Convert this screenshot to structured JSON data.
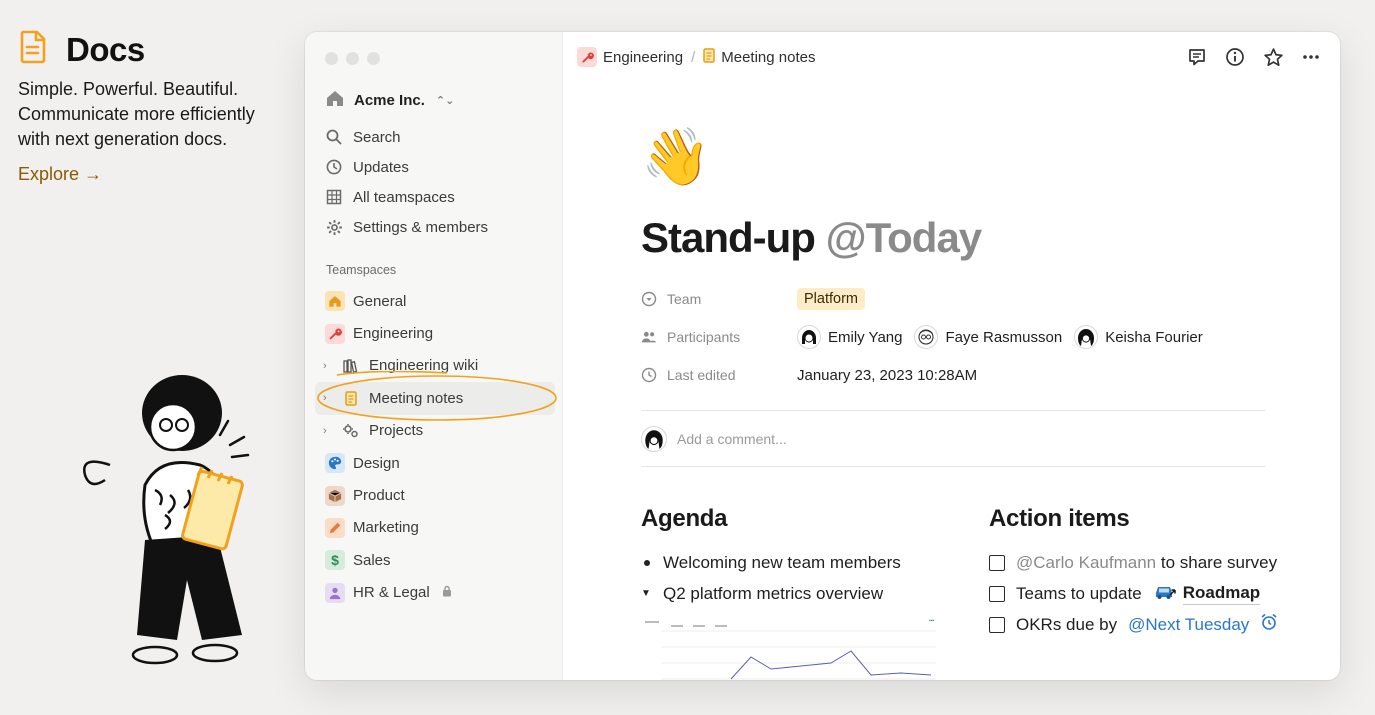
{
  "hero": {
    "title": "Docs",
    "icon": "document-icon",
    "description_lines": [
      "Simple. Powerful. Beautiful.",
      "Communicate more efficiently",
      "with next generation docs."
    ],
    "explore_label": "Explore →",
    "accent_color": "#f0a21e"
  },
  "sidebar": {
    "workspace_name": "Acme Inc.",
    "nav": [
      {
        "label": "Search",
        "icon": "search-icon"
      },
      {
        "label": "Updates",
        "icon": "clock-icon"
      },
      {
        "label": "All teamspaces",
        "icon": "grid-icon"
      },
      {
        "label": "Settings & members",
        "icon": "gear-icon"
      }
    ],
    "teamspaces_label": "Teamspaces",
    "teamspaces": [
      {
        "label": "General",
        "icon": "house-icon",
        "color": "#f2b84b"
      },
      {
        "label": "Engineering",
        "icon": "wrench-icon",
        "color": "#e5534b"
      },
      {
        "label": "Engineering wiki",
        "icon": "books-icon",
        "color": "#6b6b6b"
      },
      {
        "label": "Meeting notes",
        "icon": "notepad-icon",
        "color": "#f0a21e"
      },
      {
        "label": "Projects",
        "icon": "gears-icon",
        "color": "#6b6b6b"
      },
      {
        "label": "Design",
        "icon": "palette-icon",
        "color": "#2a78c5"
      },
      {
        "label": "Product",
        "icon": "box-icon",
        "color": "#a86f4b"
      },
      {
        "label": "Marketing",
        "icon": "pencil-icon",
        "color": "#e87a3e"
      },
      {
        "label": "Sales",
        "icon": "dollar-icon",
        "color": "#3aa05a"
      },
      {
        "label": "HR & Legal",
        "icon": "person-icon",
        "color": "#9b72c8"
      }
    ]
  },
  "topbar": {
    "crumbs": [
      {
        "label": "Engineering",
        "icon": "wrench-icon"
      },
      {
        "label": "Meeting notes",
        "icon": "notepad-icon"
      }
    ],
    "separator": "/"
  },
  "page": {
    "emoji": "👋",
    "title": "Stand-up",
    "title_mention": "@Today",
    "props": {
      "team_label": "Team",
      "team_value": "Platform",
      "participants_label": "Participants",
      "participants": [
        "Emily Yang",
        "Faye Rasmusson",
        "Keisha Fourier"
      ],
      "last_edited_label": "Last edited",
      "last_edited_value": "January 23, 2023 10:28AM"
    },
    "comment_placeholder": "Add a comment...",
    "agenda": {
      "heading": "Agenda",
      "items": [
        "Welcoming new team members",
        "Q2 platform metrics overview"
      ]
    },
    "actions": {
      "heading": "Action items",
      "item1_mention": "@Carlo Kaufmann",
      "item1_text": "to share survey",
      "item2_text": "Teams to update",
      "item2_link": "Roadmap",
      "item3_text": "OKRs due by",
      "item3_mention": "@Next Tuesday"
    }
  }
}
